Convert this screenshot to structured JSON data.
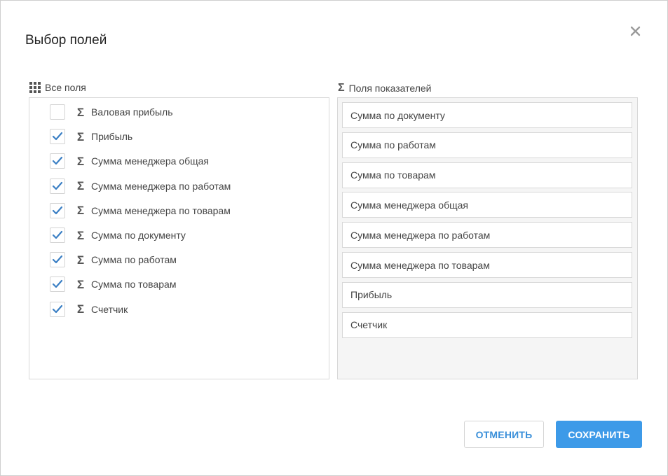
{
  "dialog": {
    "title": "Выбор полей",
    "close_icon": "close-icon"
  },
  "all_fields": {
    "header": "Все поля",
    "header_icon": "grid-icon",
    "items": [
      {
        "label": "Валовая прибыль",
        "checked": false
      },
      {
        "label": "Прибыль",
        "checked": true
      },
      {
        "label": "Сумма менеджера общая",
        "checked": true
      },
      {
        "label": "Сумма менеджера по работам",
        "checked": true
      },
      {
        "label": "Сумма менеджера по товарам",
        "checked": true
      },
      {
        "label": "Сумма по документу",
        "checked": true
      },
      {
        "label": "Сумма по работам",
        "checked": true
      },
      {
        "label": "Сумма по товарам",
        "checked": true
      },
      {
        "label": "Счетчик",
        "checked": true
      }
    ],
    "item_icon": "sigma-icon"
  },
  "measures": {
    "header": "Поля показателей",
    "header_icon": "sigma-icon",
    "items": [
      "Сумма по документу",
      "Сумма по работам",
      "Сумма по товарам",
      "Сумма менеджера общая",
      "Сумма менеджера по работам",
      "Сумма менеджера по товарам",
      "Прибыль",
      "Счетчик"
    ]
  },
  "footer": {
    "cancel_label": "ОТМЕНИТЬ",
    "save_label": "СОХРАНИТЬ"
  },
  "colors": {
    "accent": "#3d9ae8",
    "check": "#3a7fc4",
    "panel_bg": "#f5f5f5",
    "border": "#d8d8d8"
  }
}
